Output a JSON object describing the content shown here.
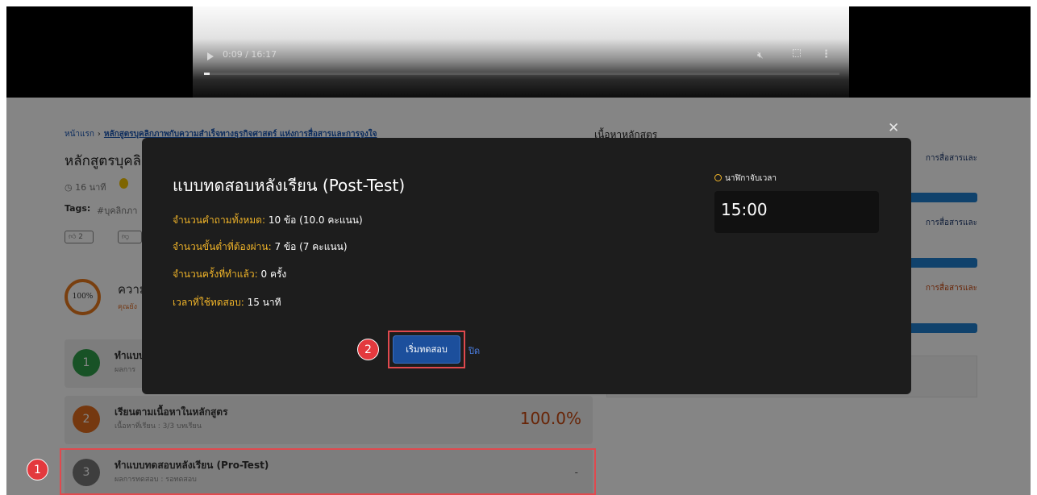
{
  "video": {
    "time": "0:09 / 16:17",
    "progress": 0.009
  },
  "breadcrumb": {
    "home": "หน้าแรก",
    "separator": "›",
    "current": "หลักสูตรบุคลิกภาพกับความสำเร็จทางธุรกิจศาสตร์ แห่งการสื่อสารและการจูงใจ"
  },
  "course": {
    "title": "หลักสูตรบุคลิก",
    "duration": "16 นาที",
    "tags_label": "Tags:",
    "tag": "#บุคลิกภา",
    "likes": "2"
  },
  "progress_section": {
    "percent": "100%",
    "heading": "ความ",
    "sub": "คุณยัง"
  },
  "steps": [
    {
      "num": "1",
      "title": "ทำแบบ",
      "sub": "ผลการ",
      "color": "#2e9e49"
    },
    {
      "num": "2",
      "title": "เรียนตามเนื้อหาในหลักสูตร",
      "sub": "เนื้อหาที่เรียน : 3/3 บทเรียน",
      "score": "100.0%",
      "color": "#e06c1e"
    },
    {
      "num": "3",
      "title": "ทำแบบทดสอบหลังเรียน (Pro-Test)",
      "sub": "ผลการทดสอบ : รอทดสอบ",
      "score": "-",
      "color": "#777777"
    }
  ],
  "sidebar": {
    "heading": "เนื้อหาหลักสูตร",
    "items": [
      "การสื่อสารและ",
      "การสื่อสารและ",
      "การสื่อสารและ"
    ]
  },
  "modal": {
    "title": "แบบทดสอบหลังเรียน (Post-Test)",
    "lines": [
      {
        "label": "จำนวนคำถามทั้งหมด:",
        "value": " 10 ข้อ (10.0 คะแนน)"
      },
      {
        "label": "จำนวนขั้นต่ำที่ต้องผ่าน:",
        "value": " 7 ข้อ (7 คะแนน)"
      },
      {
        "label": "จำนวนครั้งที่ทำแล้ว:",
        "value": " 0 ครั้ง"
      },
      {
        "label": "เวลาที่ใช้ทดสอบ:",
        "value": " 15 นาที"
      }
    ],
    "timer_label": "นาฬิกาจับเวลา",
    "timer_value": "15:00",
    "start_button": "เริ่มทดสอบ",
    "close_link": "ปิด"
  },
  "annotations": {
    "badge1": "1",
    "badge2": "2"
  },
  "colors": {
    "accent": "#1c4f9c",
    "label": "#f0b429",
    "highlight": "#e0494e"
  }
}
